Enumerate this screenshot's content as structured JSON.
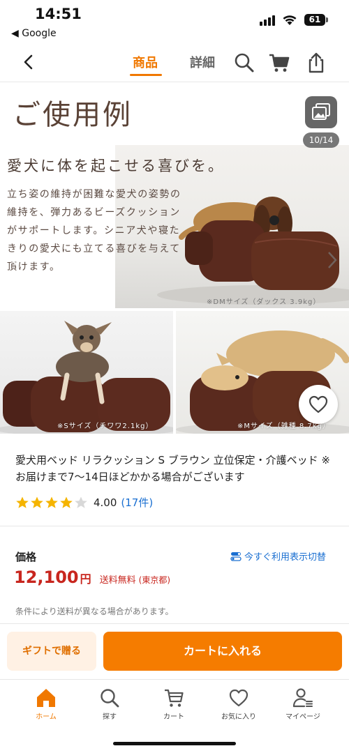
{
  "status_bar": {
    "time": "14:51",
    "back_app": "◀ Google",
    "battery": "61"
  },
  "nav": {
    "tabs": [
      {
        "label": "商品",
        "active": true
      },
      {
        "label": "詳細",
        "active": false
      }
    ]
  },
  "gallery": {
    "heading": "ご使用例",
    "counter": "10/14",
    "tagline": "愛犬に体を起こせる喜びを。",
    "description": "立ち姿の維持が困難な愛犬の姿勢の維持を、弾力あるビーズクッションがサポートします。シニア犬や寝たきりの愛犬にも立てる喜びを与えて頂けます。",
    "captions": {
      "dm": "※DMサイズ（ダックス 3.9kg）",
      "s": "※Sサイズ（チワワ2.1kg）",
      "m": "※Mサイズ（雑種 8.7kg）"
    }
  },
  "product": {
    "title": "愛犬用ベッド リラクッション S ブラウン 立位保定・介護ベッド ※お届けまで7〜14日ほどかかる場合がございます",
    "rating": {
      "value": 4.0,
      "score": "4.00",
      "count": "(17件)",
      "max": 5
    },
    "price_label": "価格",
    "toggle_label": "今すぐ利用表示切替",
    "price": "12,100",
    "price_unit": "円",
    "shipping": "送料無料",
    "region": "(東京都)",
    "shipping_note": "条件により送料が異なる場合があります。"
  },
  "actions": {
    "gift": "ギフトで贈る",
    "cart": "カートに入れる"
  },
  "tabbar": [
    {
      "label": "ホーム",
      "icon": "home-icon",
      "active": true
    },
    {
      "label": "探す",
      "icon": "search-icon",
      "active": false
    },
    {
      "label": "カート",
      "icon": "cart-icon",
      "active": false
    },
    {
      "label": "お気に入り",
      "icon": "heart-icon",
      "active": false
    },
    {
      "label": "マイページ",
      "icon": "person-icon",
      "active": false
    }
  ],
  "colors": {
    "accent": "#f07800",
    "price": "#c8261e",
    "link": "#1a6fd1",
    "cushion": "#5a2a1e"
  }
}
